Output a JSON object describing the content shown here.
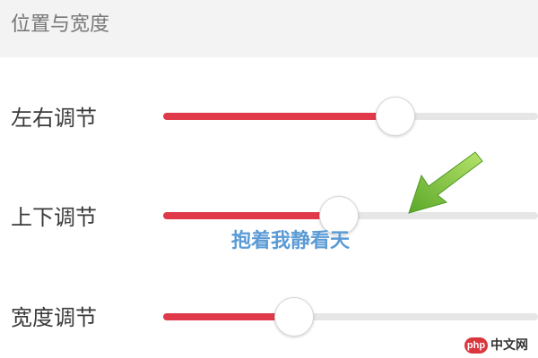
{
  "header": {
    "title": "位置与宽度"
  },
  "sliders": [
    {
      "label": "左右调节",
      "value_pct": 62
    },
    {
      "label": "上下调节",
      "value_pct": 47
    },
    {
      "label": "宽度调节",
      "value_pct": 35
    }
  ],
  "overlay": {
    "watermark_text": "抱着我静看天"
  },
  "brand": {
    "badge": "php",
    "name": "中文网"
  },
  "colors": {
    "accent": "#e03a4a",
    "track": "#e6e6e6",
    "arrow": "#7ac143"
  },
  "icons": {
    "pointer": "green-arrow-icon"
  }
}
